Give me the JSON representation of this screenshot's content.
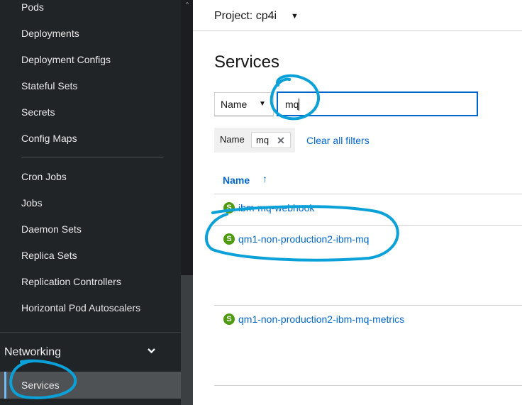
{
  "sidebar": {
    "items": [
      {
        "label": "Pods"
      },
      {
        "label": "Deployments"
      },
      {
        "label": "Deployment Configs"
      },
      {
        "label": "Stateful Sets"
      },
      {
        "label": "Secrets"
      },
      {
        "label": "Config Maps"
      },
      {
        "label": "Cron Jobs"
      },
      {
        "label": "Jobs"
      },
      {
        "label": "Daemon Sets"
      },
      {
        "label": "Replica Sets"
      },
      {
        "label": "Replication Controllers"
      },
      {
        "label": "Horizontal Pod Autoscalers"
      }
    ],
    "section": {
      "label": "Networking"
    },
    "active_item": {
      "label": "Services"
    }
  },
  "project": {
    "label": "Project: cp4i"
  },
  "page": {
    "title": "Services"
  },
  "filter": {
    "type_selected": "Name",
    "input_value": "mq"
  },
  "chips": {
    "category": "Name",
    "value": "mq",
    "clear_label": "Clear all filters"
  },
  "table": {
    "column": "Name",
    "rows": [
      {
        "badge": "S",
        "name": "ibm-mq-webhook"
      },
      {
        "badge": "S",
        "name": "qm1-non-production2-ibm-mq"
      },
      {
        "badge": "S",
        "name": "qm1-non-production2-ibm-mq-metrics"
      }
    ]
  },
  "colors": {
    "sidebar_bg": "#212427",
    "link": "#0066cc",
    "service_badge": "#4f9b0f",
    "annotation": "#0aa0d8"
  }
}
